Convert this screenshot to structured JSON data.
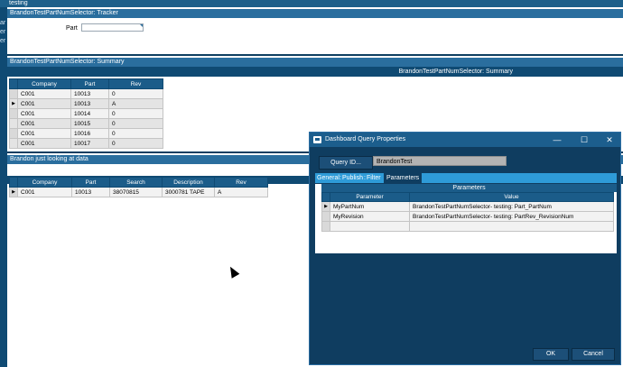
{
  "window": {
    "title": "testing"
  },
  "leftbar": {
    "items": [
      "ar",
      "er",
      "er"
    ]
  },
  "tracker": {
    "header": "BrandonTestPartNumSelector: Tracker",
    "part_label": "Part",
    "part_value": ""
  },
  "summary": {
    "header": "BrandonTestPartNumSelector: Summary",
    "grid_title": "BrandonTestPartNumSelector: Summary",
    "columns": [
      "Company",
      "Part",
      "Rev"
    ],
    "rows": [
      [
        "C001",
        "10013",
        "0"
      ],
      [
        "C001",
        "10013",
        "A"
      ],
      [
        "C001",
        "10014",
        "0"
      ],
      [
        "C001",
        "10015",
        "0"
      ],
      [
        "C001",
        "10016",
        "0"
      ],
      [
        "C001",
        "10017",
        "0"
      ]
    ]
  },
  "lookup": {
    "header": "Brandon just looking at data",
    "columns": [
      "Company",
      "Part",
      "Search",
      "Description",
      "Rev"
    ],
    "rows": [
      [
        "C001",
        "10013",
        "38070815",
        "3000781 TAPE",
        "A"
      ]
    ]
  },
  "dialog": {
    "title": "Dashboard Query Properties",
    "minimize": "—",
    "maximize": "☐",
    "close": "✕",
    "query_id_button": "Query ID...",
    "query_id_value": "BrandonTest",
    "tabs": [
      "General",
      "Publish",
      "Filter",
      "Parameters"
    ],
    "active_tab": "Parameters",
    "params_title": "Parameters",
    "param_columns": [
      "Parameter",
      "Value"
    ],
    "param_rows": [
      [
        "MyPartNum",
        "BrandonTestPartNumSelector- testing: Part_PartNum"
      ],
      [
        "MyRevision",
        "BrandonTestPartNumSelector- testing: PartRev_RevisionNum"
      ],
      [
        "",
        ""
      ]
    ],
    "ok_label": "OK",
    "cancel_label": "Cancel"
  }
}
